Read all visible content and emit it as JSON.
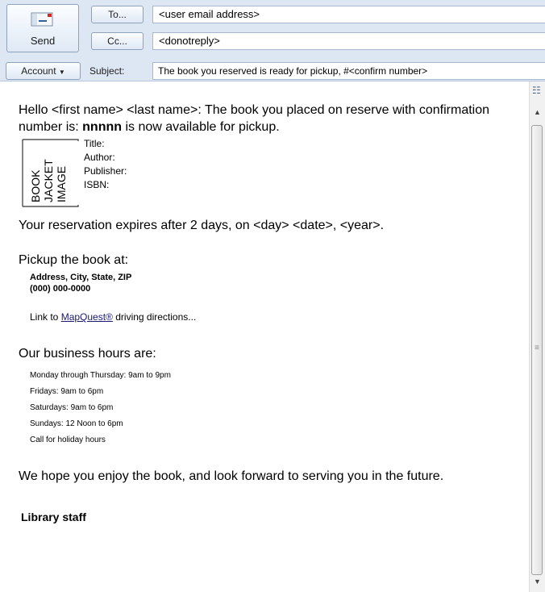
{
  "header": {
    "send_label": "Send",
    "to_label": "To...",
    "cc_label": "Cc...",
    "to_value": "<user email address>",
    "cc_value": "<donotreply>",
    "account_label": "Account",
    "subject_label": "Subject:",
    "subject_value": "The book you reserved is ready for pickup, #<confirm number>"
  },
  "message": {
    "intro_part1": "Hello <first name> <last name>: The book you placed on reserve with confirmation number is: ",
    "confirm_number": "nnnnn",
    "intro_part2": " is now available for pickup.",
    "book_image_line1": "BOOK",
    "book_image_line2": "JACKET",
    "book_image_line3": "IMAGE",
    "book_fields": [
      "Title:",
      "Author:",
      "Publisher:",
      "ISBN:"
    ],
    "expires": "Your reservation expires after 2 days, on <day> <date>, <year>.",
    "pickup_heading": "Pickup the book at:",
    "address_line1": "Address, City, State, ZIP",
    "address_line2": "(000) 000-0000",
    "link_prefix": "Link to ",
    "link_text": "MapQuest®",
    "link_suffix": " driving directions...",
    "hours_heading": "Our business hours are:",
    "hours": [
      "Monday through Thursday: 9am to 9pm",
      "Fridays: 9am to 6pm",
      "Saturdays: 9am to 6pm",
      "Sundays: 12 Noon to 6pm",
      "Call for holiday hours"
    ],
    "closing": "We hope you enjoy the book, and look forward to serving you in the future.",
    "signature": "Library staff"
  },
  "icons": {
    "send": "envelope-icon",
    "account_dropdown": "chevron-down-icon"
  }
}
